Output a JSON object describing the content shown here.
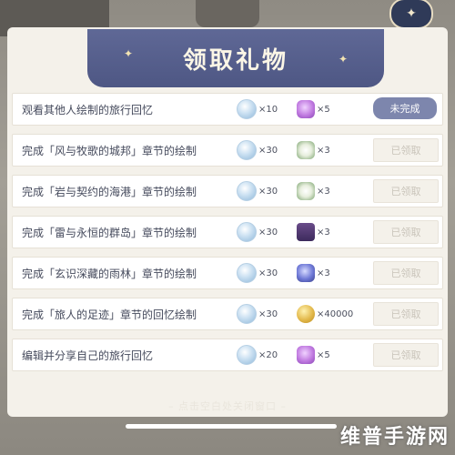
{
  "header": {
    "title": "领取礼物"
  },
  "rows": [
    {
      "label": "观看其他人绘制的旅行回忆",
      "reward1": {
        "icon": "gem-icon",
        "qty": "×10"
      },
      "reward2": {
        "icon": "purple-crystal-icon",
        "qty": "×5"
      },
      "status": "未完成"
    },
    {
      "label": "完成「风与牧歌的城邦」章节的绘制",
      "reward1": {
        "icon": "gem-icon",
        "qty": "×30"
      },
      "reward2": {
        "icon": "white-flower-icon",
        "qty": "×3"
      },
      "status": "已领取"
    },
    {
      "label": "完成「岩与契约的海港」章节的绘制",
      "reward1": {
        "icon": "gem-icon",
        "qty": "×30"
      },
      "reward2": {
        "icon": "white-flower-icon",
        "qty": "×3"
      },
      "status": "已领取"
    },
    {
      "label": "完成「雷与永恒的群岛」章节的绘制",
      "reward1": {
        "icon": "gem-icon",
        "qty": "×30"
      },
      "reward2": {
        "icon": "purple-box-icon",
        "qty": "×3"
      },
      "status": "已领取"
    },
    {
      "label": "完成「玄识深藏的雨林」章节的绘制",
      "reward1": {
        "icon": "gem-icon",
        "qty": "×30"
      },
      "reward2": {
        "icon": "blue-flower-icon",
        "qty": "×3"
      },
      "status": "已领取"
    },
    {
      "label": "完成「旅人的足迹」章节的回忆绘制",
      "reward1": {
        "icon": "gem-icon",
        "qty": "×30"
      },
      "reward2": {
        "icon": "gold-coin-icon",
        "qty": "×40000"
      },
      "status": "已领取"
    },
    {
      "label": "编辑并分享自己的旅行回忆",
      "reward1": {
        "icon": "gem-icon",
        "qty": "×20"
      },
      "reward2": {
        "icon": "purple-crystal-icon",
        "qty": "×5"
      },
      "status": "已领取"
    }
  ],
  "footer": {
    "close_hint": "– 点击空白处关闭窗口 –"
  },
  "watermark": "维普手游网",
  "colors": {
    "header": "#5a6390",
    "pending_button": "#7d86ad",
    "claimed_text": "#c9c4ba",
    "label_text": "#454a5c"
  }
}
